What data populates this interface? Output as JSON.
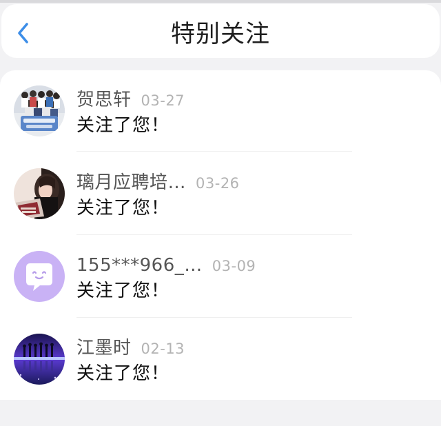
{
  "header": {
    "back_icon": "chevron-left-icon",
    "title": "特别关注"
  },
  "colors": {
    "accent": "#3d8ee8",
    "background": "#f2f2f4",
    "card": "#ffffff",
    "name_text": "#555555",
    "date_text": "#b3b3b3"
  },
  "notifications": [
    {
      "name": "贺思轩",
      "date": "03-27",
      "message": "关注了您！",
      "avatar": "group-photo-avatar"
    },
    {
      "name": "璃月应聘培…",
      "date": "03-26",
      "message": "关注了您！",
      "avatar": "portrait-photo-avatar"
    },
    {
      "name": "155***966_…",
      "date": "03-09",
      "message": "关注了您！",
      "avatar": "default-chat-bubble-avatar"
    },
    {
      "name": "江墨时",
      "date": "02-13",
      "message": "关注了您！",
      "avatar": "stage-photo-avatar"
    }
  ]
}
